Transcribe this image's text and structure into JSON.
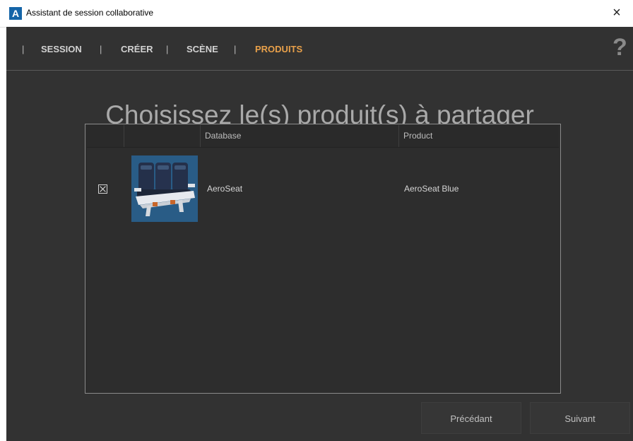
{
  "window": {
    "app_icon_letter": "A",
    "title": "Assistant de session collaborative",
    "close_symbol": "×"
  },
  "nav": {
    "separator": "|",
    "items": [
      {
        "label": "SESSION",
        "active": false
      },
      {
        "label": "CRÉER",
        "active": false
      },
      {
        "label": "SCÈNE",
        "active": false
      },
      {
        "label": "PRODUITS",
        "active": true
      }
    ],
    "help_symbol": "?",
    "active_color": "#e8a04a"
  },
  "page": {
    "title": "Choisissez le(s) produit(s) à partager"
  },
  "table": {
    "headers": [
      "",
      "",
      "Database",
      "Product"
    ],
    "rows": [
      {
        "checked": true,
        "thumbnail_icon": "aircraft-seat-thumbnail",
        "database": "AeroSeat",
        "product": "AeroSeat Blue"
      }
    ]
  },
  "buttons": {
    "previous": "Précédant",
    "next": "Suivant"
  },
  "colors": {
    "background": "#323232",
    "accent": "#e8a04a",
    "brand": "#1565a8"
  }
}
